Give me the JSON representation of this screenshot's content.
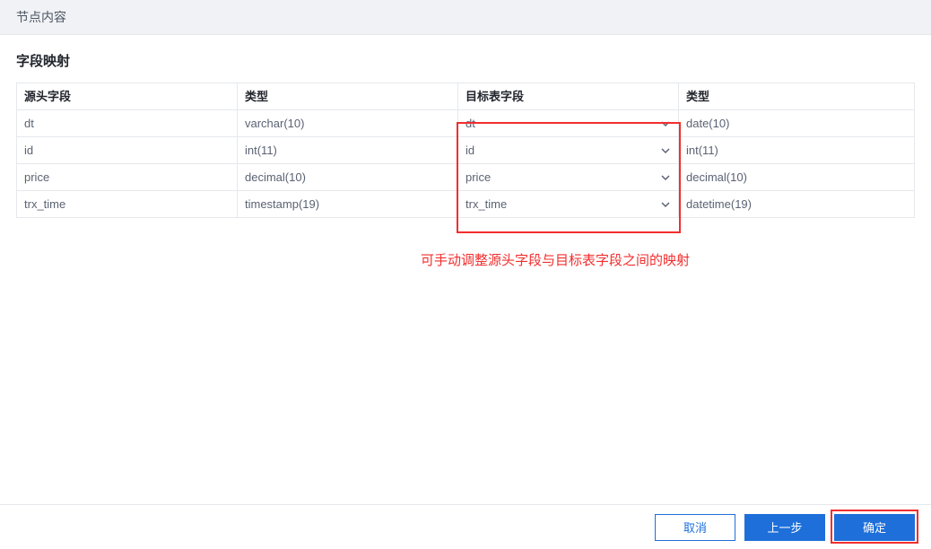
{
  "header": {
    "title": "节点内容"
  },
  "section": {
    "title": "字段映射"
  },
  "columns": {
    "source_field": "源头字段",
    "source_type": "类型",
    "target_field": "目标表字段",
    "target_type": "类型"
  },
  "rows": [
    {
      "source_field": "dt",
      "source_type": "varchar(10)",
      "target_field": "dt",
      "target_type": "date(10)"
    },
    {
      "source_field": "id",
      "source_type": "int(11)",
      "target_field": "id",
      "target_type": "int(11)"
    },
    {
      "source_field": "price",
      "source_type": "decimal(10)",
      "target_field": "price",
      "target_type": "decimal(10)"
    },
    {
      "source_field": "trx_time",
      "source_type": "timestamp(19)",
      "target_field": "trx_time",
      "target_type": "datetime(19)"
    }
  ],
  "annotation": {
    "text": "可手动调整源头字段与目标表字段之间的映射"
  },
  "buttons": {
    "cancel": "取消",
    "prev": "上一步",
    "confirm": "确定"
  }
}
